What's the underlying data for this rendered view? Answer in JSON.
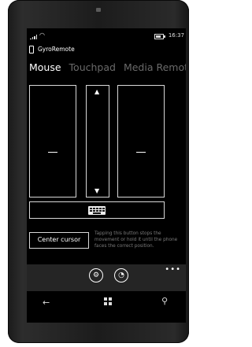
{
  "status_bar": {
    "time": "16:37",
    "battery_level": 0.7
  },
  "app": {
    "title": "GyroRemote"
  },
  "pivot": {
    "items": [
      "Mouse",
      "Touchpad",
      "Media Remote"
    ],
    "active_index": 0
  },
  "mouse": {
    "left_button_symbol": "–",
    "right_button_symbol": "–",
    "scroll_up_symbol": "▲",
    "scroll_down_symbol": "▼"
  },
  "keyboard": {
    "icon": "keyboard-icon"
  },
  "center": {
    "button_label": "Center cursor",
    "hint": "Tapping this button stops the movement or hold it until the phone faces the correct position."
  },
  "app_bar": {
    "settings_icon": "⚙",
    "speedometer_icon": "◔",
    "more": "•••"
  },
  "nav_bar": {
    "back": "←",
    "search": "⚲"
  }
}
